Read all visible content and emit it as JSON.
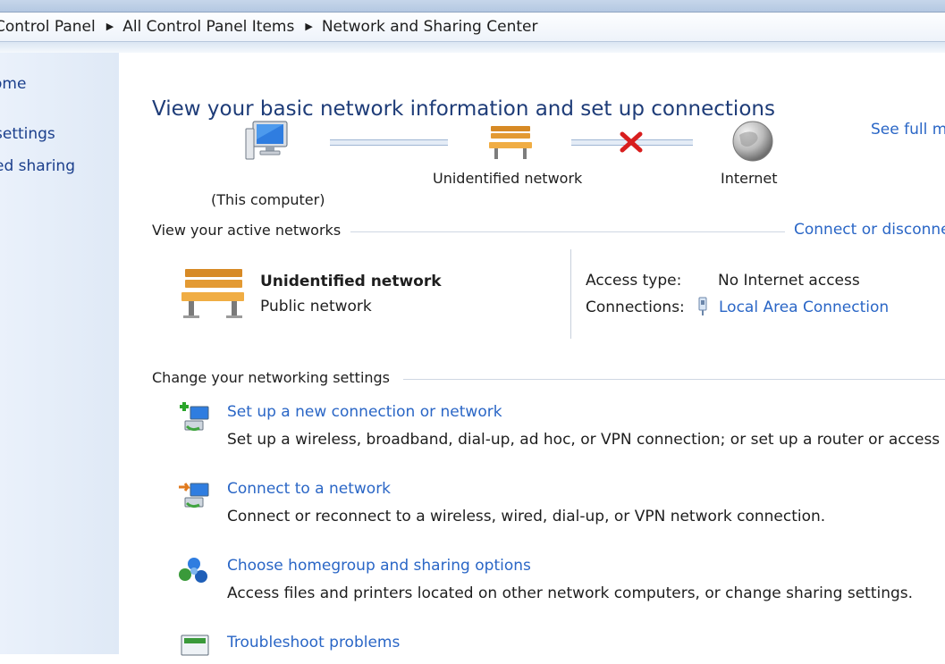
{
  "breadcrumb": [
    "Control Panel",
    "All Control Panel Items",
    "Network and Sharing Center"
  ],
  "sidebar": {
    "home": "ome",
    "adapter": " settings",
    "advanced": "ed sharing"
  },
  "main": {
    "title": "View your basic network information and set up connections",
    "full_map_link": "See full m",
    "map": {
      "computer_label": "(This computer)",
      "network_label": "Unidentified network",
      "internet_label": "Internet"
    },
    "active": {
      "heading": "View your active networks",
      "connect_link": "Connect or disconne",
      "network_name": "Unidentified network",
      "network_type": "Public network",
      "access_type_label": "Access type:",
      "access_type_value": "No Internet access",
      "connections_label": "Connections:",
      "connections_value": "Local Area Connection"
    },
    "change": {
      "heading": "Change your networking settings",
      "tasks": [
        {
          "link": "Set up a new connection or network",
          "desc": "Set up a wireless, broadband, dial-up, ad hoc, or VPN connection; or set up a router or access poir"
        },
        {
          "link": "Connect to a network",
          "desc": "Connect or reconnect to a wireless, wired, dial-up, or VPN network connection."
        },
        {
          "link": "Choose homegroup and sharing options",
          "desc": "Access files and printers located on other network computers, or change sharing settings."
        },
        {
          "link": "Troubleshoot problems",
          "desc": ""
        }
      ]
    }
  },
  "colors": {
    "link": "#2a66c6",
    "title": "#1e3c78",
    "sidebar_bg": "#e3ecf8",
    "error_x": "#d81e1e"
  }
}
